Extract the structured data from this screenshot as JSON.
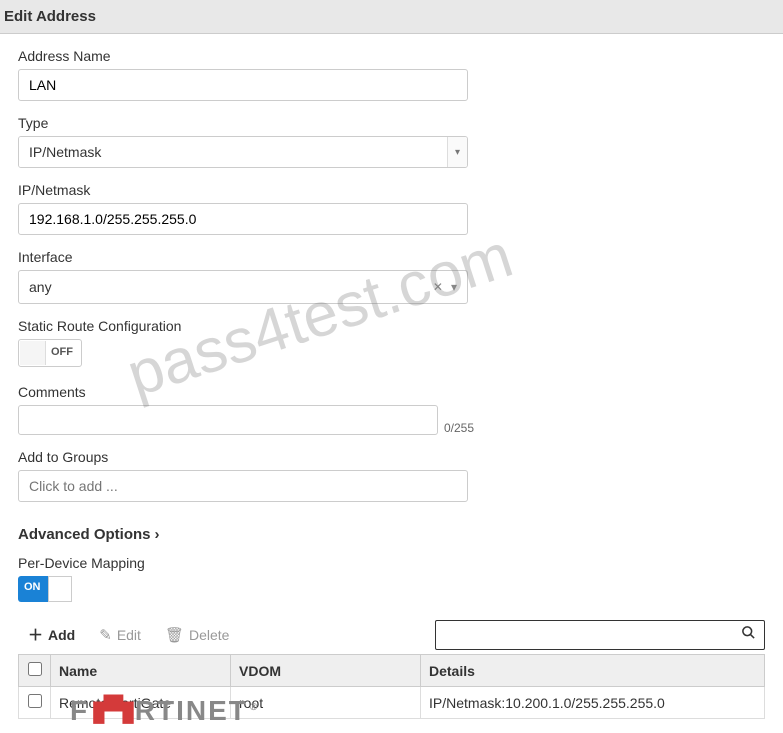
{
  "header": {
    "title": "Edit Address"
  },
  "form": {
    "addressName": {
      "label": "Address Name",
      "value": "LAN"
    },
    "type": {
      "label": "Type",
      "value": "IP/Netmask"
    },
    "ipNetmask": {
      "label": "IP/Netmask",
      "value": "192.168.1.0/255.255.255.0"
    },
    "interface": {
      "label": "Interface",
      "value": "any"
    },
    "staticRoute": {
      "label": "Static Route Configuration",
      "state": "OFF"
    },
    "comments": {
      "label": "Comments",
      "value": "",
      "counter": "0/255"
    },
    "addToGroups": {
      "label": "Add to Groups",
      "placeholder": "Click to add ..."
    },
    "advancedOptions": {
      "label": "Advanced Options"
    },
    "perDeviceMapping": {
      "label": "Per-Device Mapping",
      "state": "ON"
    }
  },
  "toolbar": {
    "add": "Add",
    "edit": "Edit",
    "delete": "Delete"
  },
  "table": {
    "headers": {
      "name": "Name",
      "vdom": "VDOM",
      "details": "Details"
    },
    "rows": [
      {
        "name": "Remote-FortiGate",
        "vdom": "root",
        "details": "IP/Netmask:10.200.1.0/255.255.255.0"
      }
    ]
  },
  "watermark": "pass4test.com",
  "logo": {
    "text_a": "F",
    "blocks": "▮▀▮",
    "text_b": "RTINET",
    "reg": "®"
  }
}
